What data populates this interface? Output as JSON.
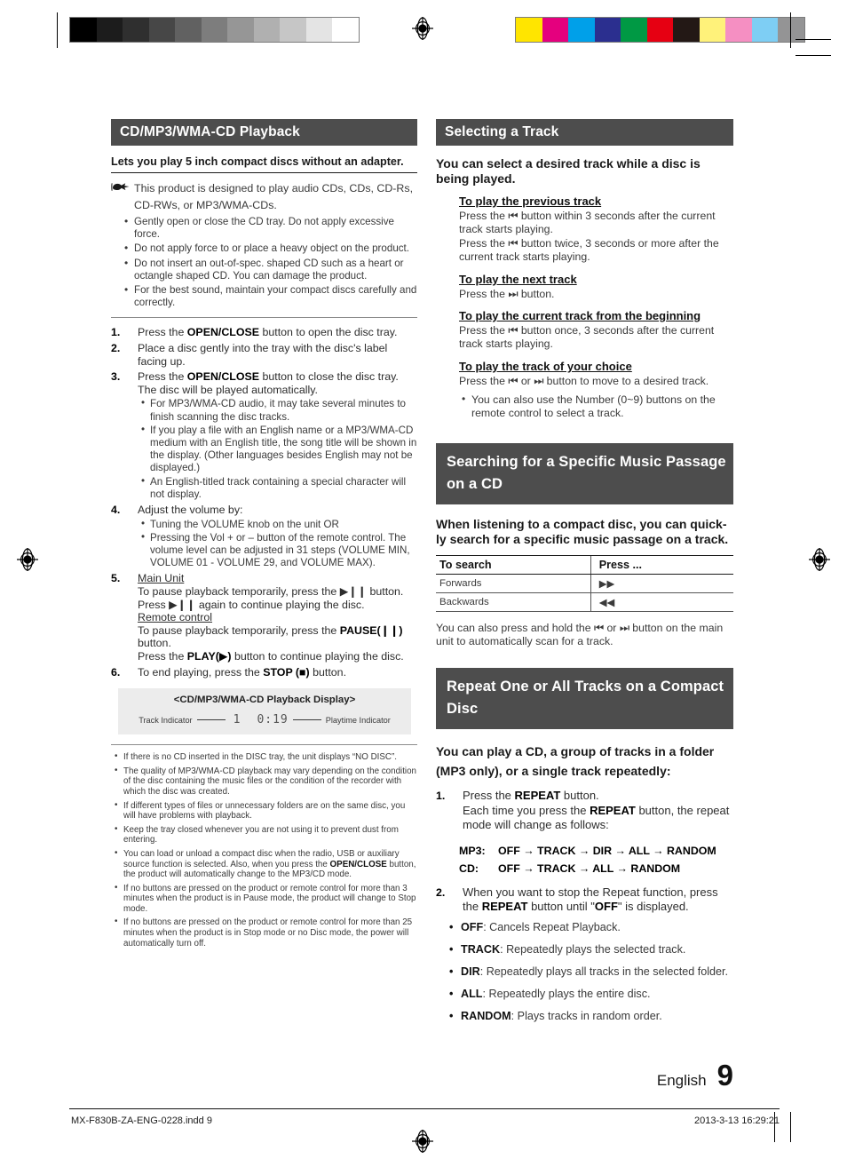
{
  "printmarks": {
    "gray_swatches": [
      "#000000",
      "#1c1c1c",
      "#2f2f2f",
      "#474747",
      "#616161",
      "#7d7d7d",
      "#969696",
      "#b0b0b0",
      "#c6c6c6",
      "#e4e4e4",
      "#ffffff"
    ],
    "color_swatches": [
      "#ffe500",
      "#e5007e",
      "#00a0e9",
      "#2b2f8f",
      "#009944",
      "#e60012",
      "#231815",
      "#fff27a",
      "#f58fc2",
      "#7ecef4",
      "#949495"
    ],
    "reg_icon": "registration-target-icon"
  },
  "left": {
    "section_title": "CD/MP3/WMA-CD Playback",
    "lead": "Lets you play 5 inch compact discs without an adapter.",
    "hand_icon": "pointing-hand-icon",
    "hand_note": "This product is designed to play audio CDs, CDs, CD-Rs, CD-RWs, or MP3/WMA-CDs.",
    "cautions": [
      "Gently open or close the CD tray. Do not apply excessive force.",
      "Do not apply force to or place a heavy object on the product.",
      "Do not insert an out-of-spec. shaped CD such as a heart or octangle shaped CD. You can damage the product.",
      "For the best sound, maintain your compact discs carefully and correctly."
    ],
    "steps": [
      {
        "num": "1.",
        "text_html": "Press the <b>OPEN/CLOSE</b> button to open the disc tray.",
        "subs": []
      },
      {
        "num": "2.",
        "text_html": "Place a disc gently into the tray with the disc's label facing up.",
        "subs": []
      },
      {
        "num": "3.",
        "text_html": "Press the <b>OPEN/CLOSE</b> button to close the disc tray. The disc will be played automatically.",
        "subs": [
          "For MP3/WMA-CD audio, it may take several minutes to finish scanning the disc tracks.",
          "If you play a file with an English name or a MP3/WMA-CD medium with an English title, the song title will be shown in the display. (Other languages besides English may not be displayed.)",
          "An English-titled track containing a special character will not display."
        ]
      },
      {
        "num": "4.",
        "text_html": "Adjust the volume by:",
        "subs": [
          "Tuning the VOLUME knob on the unit OR",
          "Pressing the Vol + or &#8211; button of the remote control. The volume level can be adjusted in 31 steps (VOLUME MIN, VOLUME 01 - VOLUME 29, and VOLUME MAX)."
        ]
      },
      {
        "num": "5.",
        "text_html": "<u>Main Unit</u><br>To pause playback temporarily, press the &#9654;&#10073;&#10073; button. Press &#9654;&#10073;&#10073; again to continue playing the disc.<br><u>Remote control</u><br>To pause playback temporarily, press the <b>PAUSE(&#10073;&#10073;)</b> button.<br>Press the <b>PLAY(&#9654;)</b> button to continue playing the disc.",
        "subs": []
      },
      {
        "num": "6.",
        "text_html": "To end playing, press the <b>STOP (&#9632;)</b> button.",
        "subs": []
      }
    ],
    "display_box": {
      "title": "<CD/MP3/WMA-CD Playback Display>",
      "left_label": "Track Indicator",
      "track_value": "1",
      "time_value": "0:19",
      "right_label": "Playtime Indicator"
    },
    "notes": [
      "If there is no CD inserted in the DISC tray, the unit displays &ldquo;NO DISC&rdquo;.",
      "The quality of MP3/WMA-CD playback may vary depending on the condition of the disc containing the music files or the condition of the recorder with which the disc was created.",
      "If different types of files or unnecessary folders are on the same disc, you will have problems with playback.",
      "Keep the tray closed whenever you are not using it to prevent dust from entering.",
      "You can load or unload a compact disc when the radio, USB or auxiliary source function is selected. Also, when you press the <b>OPEN/CLOSE</b> button, the product will automatically change to the MP3/CD mode.",
      "If no buttons are pressed on the product or remote control for more than 3 minutes when the product is in Pause mode, the product will change to Stop mode.",
      "If no buttons are pressed on the product or remote control for more than 25 minutes when the product is in Stop mode or no Disc mode, the power will automatically turn off."
    ]
  },
  "right": {
    "track_section": {
      "title": "Selecting a Track",
      "intro": "You can select a desired track while a disc is being played.",
      "blocks": [
        {
          "heading": "To play the previous track",
          "body_html": "Press the &#9198; button within 3 seconds after the current track starts playing.<br>Press the &#9198; button twice, 3 seconds or more after the current track starts playing."
        },
        {
          "heading": "To play the next track",
          "body_html": "Press the &#9197; button."
        },
        {
          "heading": "To play the current track from the beginning",
          "body_html": "Press the &#9198; button once, 3 seconds after the current track starts playing."
        },
        {
          "heading": "To play the track of your choice",
          "body_html": "Press the &#9198; or &#9197; button to move to a desired track."
        }
      ],
      "bullet": "You can also use the Number (0~9) buttons on the remote control to select a track."
    },
    "search_section": {
      "title": "Searching for a Specific Music Passage on a CD",
      "intro": "When listening to a compact disc, you can quick-ly search for a specific music passage on a track.",
      "table": {
        "headers": [
          "To search",
          "Press ..."
        ],
        "rows": [
          {
            "label": "Forwards",
            "icon": "▶▶"
          },
          {
            "label": "Backwards",
            "icon": "◀◀"
          }
        ]
      },
      "after": "You can also press and hold the &#9198; or &#9197; button on the main unit to automatically scan for a track."
    },
    "repeat_section": {
      "title": "Repeat One or All Tracks on a Compact Disc",
      "intro": "You can play a CD, a group of tracks in a folder (MP3 only), or a single track repeatedly:",
      "steps": [
        {
          "num": "1.",
          "text_html": "Press the <b>REPEAT</b> button.<br>Each time you press the <b>REPEAT</b> button, the repeat mode will change as follows:"
        },
        {
          "num": "2.",
          "text_html": "When you want to stop the Repeat function, press the <b>REPEAT</b> button until &quot;<b>OFF</b>&quot; is displayed."
        }
      ],
      "modes": [
        {
          "label": "MP3:",
          "seq": "OFF → TRACK → DIR → ALL → RANDOM"
        },
        {
          "label": "CD:",
          "seq": "OFF → TRACK → ALL → RANDOM"
        }
      ],
      "definitions": [
        {
          "term": "OFF",
          "desc": ": Cancels Repeat Playback."
        },
        {
          "term": "TRACK",
          "desc": ": Repeatedly plays the selected track."
        },
        {
          "term": "DIR",
          "desc": ": Repeatedly plays all tracks in the selected folder."
        },
        {
          "term": "ALL",
          "desc": ": Repeatedly plays the entire disc."
        },
        {
          "term": "RANDOM",
          "desc": ": Plays tracks in random order."
        }
      ]
    }
  },
  "footer": {
    "language": "English",
    "page_number": "9",
    "file_name": "MX-F830B-ZA-ENG-0228.indd   9",
    "timestamp": "2013-3-13   16:29:21"
  }
}
